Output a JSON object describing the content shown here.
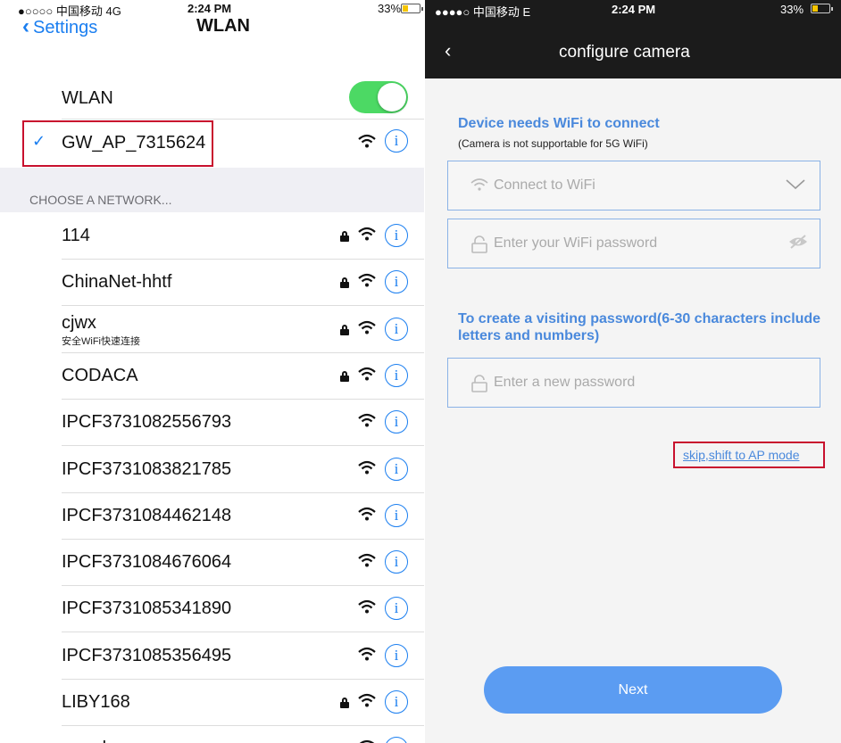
{
  "left": {
    "status": {
      "carrier": "●○○○○ 中国移动  4G",
      "time": "2:24 PM",
      "battery": "33%"
    },
    "nav": {
      "back_label": "Settings",
      "title": "WLAN"
    },
    "wlan_label": "WLAN",
    "wlan_on": true,
    "connected_network": "GW_AP_7315624",
    "section_header": "CHOOSE A NETWORK...",
    "networks": [
      {
        "name": "114",
        "sub": "",
        "locked": true
      },
      {
        "name": "ChinaNet-hhtf",
        "sub": "",
        "locked": true
      },
      {
        "name": "cjwx",
        "sub": "安全WiFi快速连接",
        "locked": true
      },
      {
        "name": "CODACA",
        "sub": "",
        "locked": true
      },
      {
        "name": "IPCF3731082556793",
        "sub": "",
        "locked": false
      },
      {
        "name": "IPCF3731083821785",
        "sub": "",
        "locked": false
      },
      {
        "name": "IPCF3731084462148",
        "sub": "",
        "locked": false
      },
      {
        "name": "IPCF3731084676064",
        "sub": "",
        "locked": false
      },
      {
        "name": "IPCF3731085341890",
        "sub": "",
        "locked": false
      },
      {
        "name": "IPCF3731085356495",
        "sub": "",
        "locked": false
      },
      {
        "name": "LIBY168",
        "sub": "",
        "locked": true
      },
      {
        "name": "raresky",
        "sub": "",
        "locked": true
      }
    ]
  },
  "right": {
    "status": {
      "carrier": "●●●●○ 中国移动  E",
      "time": "2:24 PM",
      "battery": "33%"
    },
    "title": "configure camera",
    "wifi_heading": "Device needs WiFi to connect",
    "wifi_note": "(Camera is not supportable for 5G WiFi)",
    "wifi_select_placeholder": "Connect to WiFi",
    "wifi_password_placeholder": "Enter your WiFi password",
    "visit_heading": "To create a visiting password(6-30 characters include letters and numbers)",
    "new_password_placeholder": "Enter a new password",
    "skip_link": "skip,shift to AP mode",
    "next_label": "Next"
  },
  "colors": {
    "ios_blue": "#1a7ef0",
    "toggle_green": "#4cd964",
    "app_blue": "#4a89dc",
    "button_blue": "#5b9cf2",
    "highlight_red": "#c8102e"
  },
  "battery_level": 0.33
}
